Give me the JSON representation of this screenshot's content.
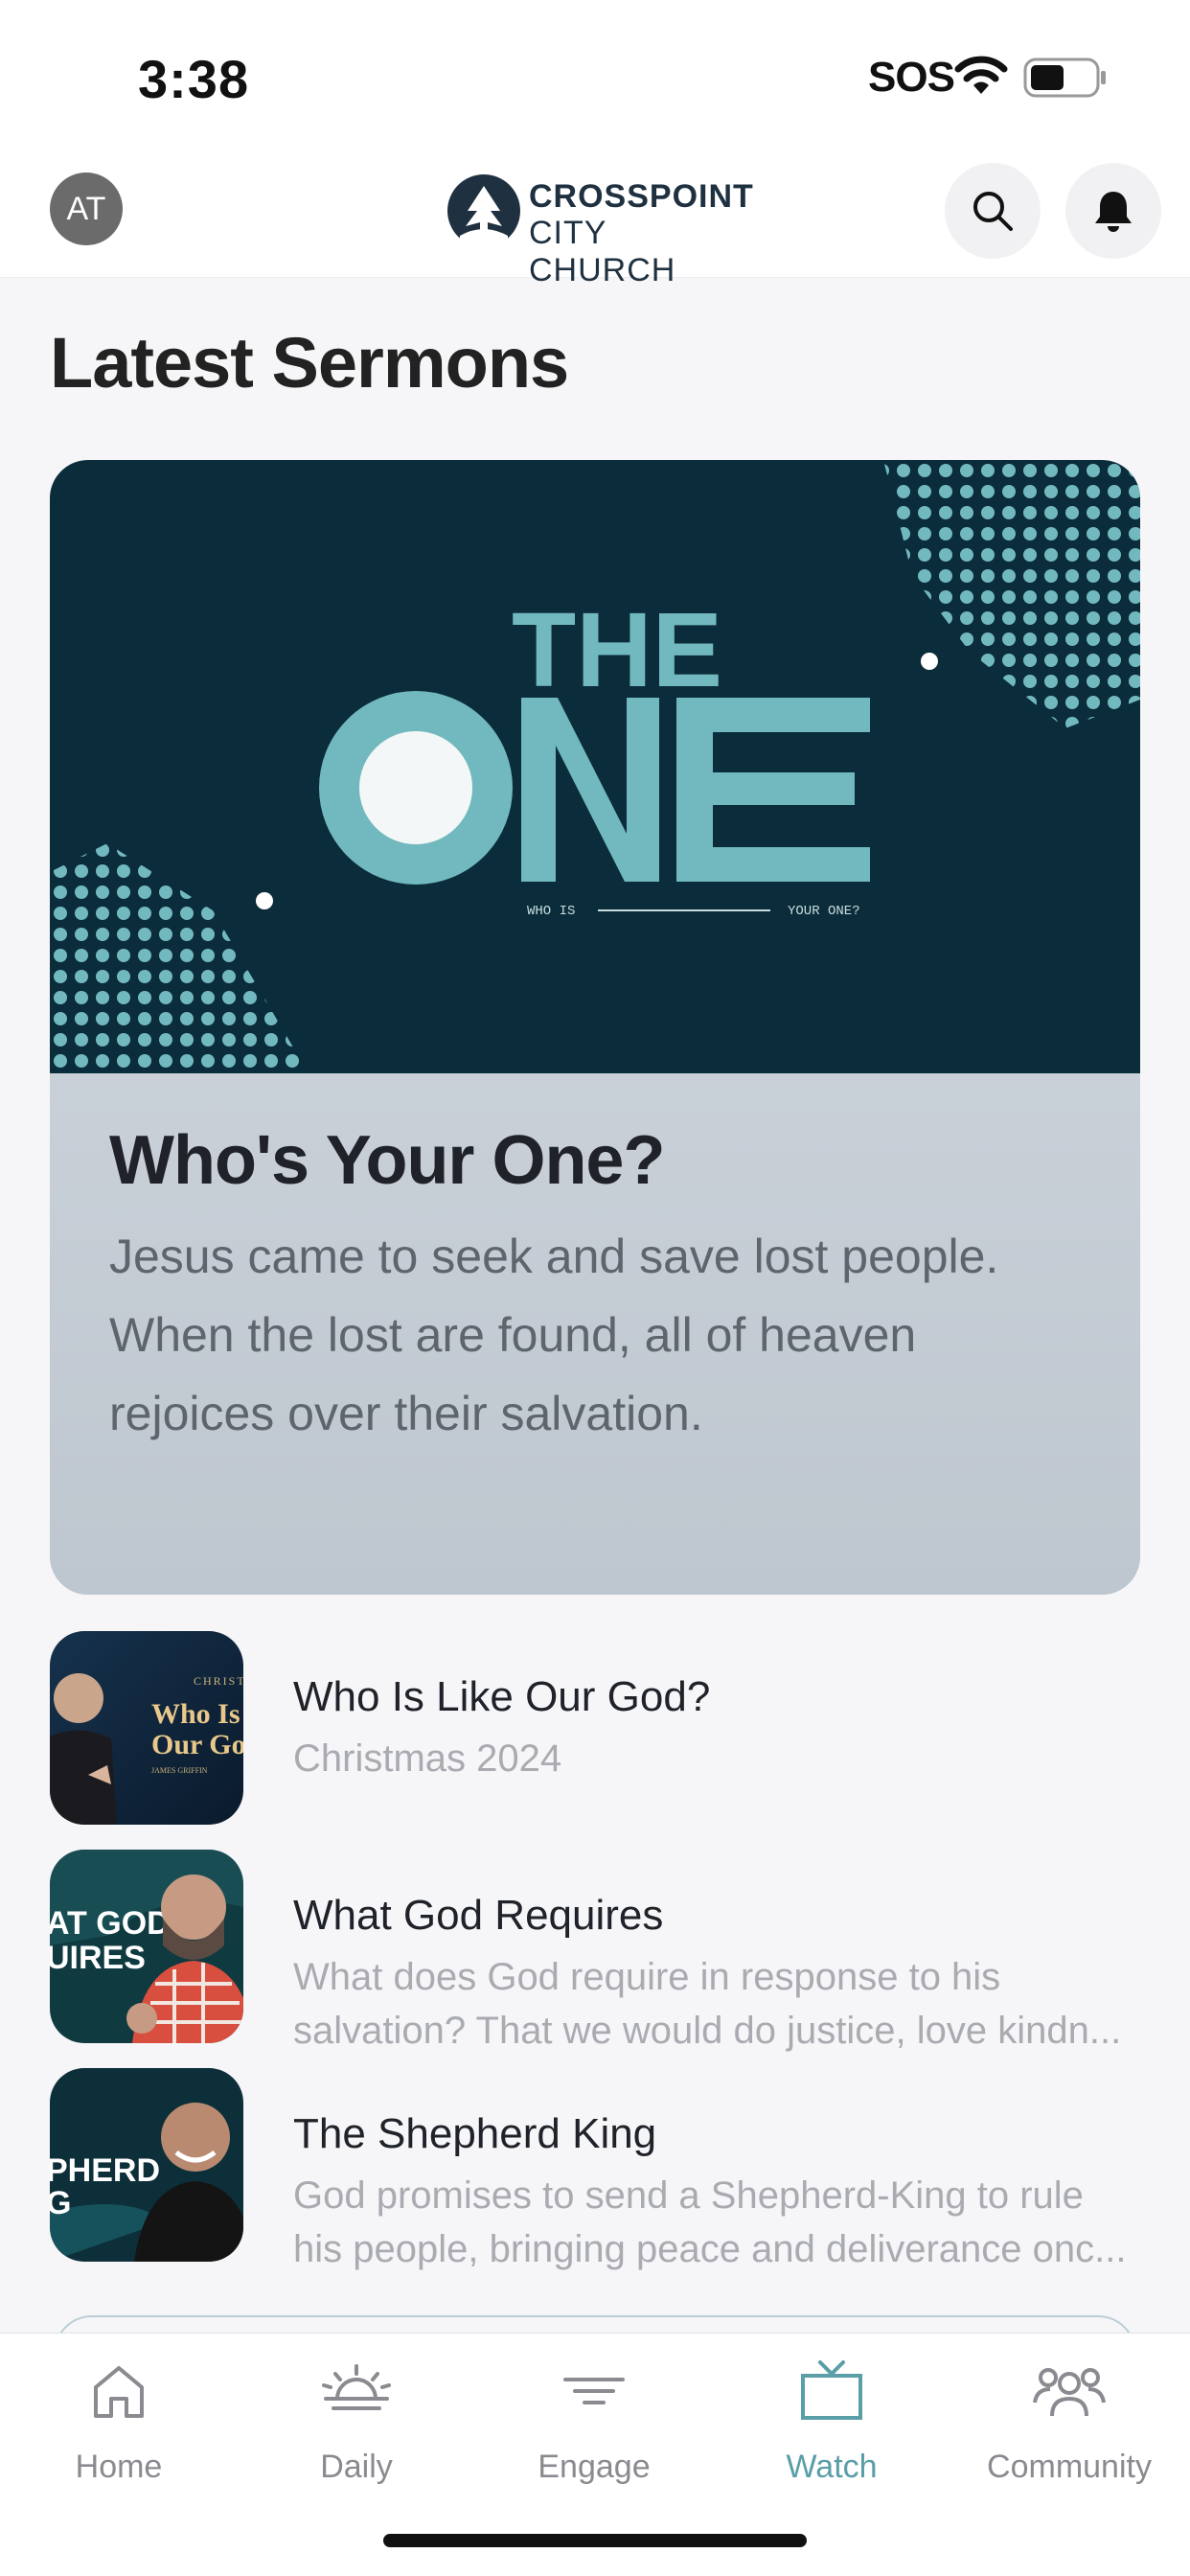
{
  "status_bar": {
    "time": "3:38",
    "carrier": "SOS"
  },
  "header": {
    "avatar_initials": "AT",
    "logo_line1": "CROSSPOINT",
    "logo_line2": "CITY CHURCH"
  },
  "section_title": "Latest Sermons",
  "featured": {
    "art_the": "THE",
    "art_one": "ONE",
    "art_left_caption": "WHO IS",
    "art_right_caption": "YOUR ONE?",
    "title": "Who's Your One?",
    "description": "Jesus came to seek and save lost people. When the lost are found, all of heaven rejoices over their salvation."
  },
  "sermons": [
    {
      "title": "Who Is Like Our God?",
      "subtitle_line1": "Christmas 2024",
      "subtitle_line2": "",
      "thumb_text": "Who Is Our God"
    },
    {
      "title": "What God Requires",
      "subtitle_line1": "What does God require in response to his",
      "subtitle_line2": "salvation? That we would do justice, love kindn...",
      "thumb_text": "AT GOD UIRES"
    },
    {
      "title": "The Shepherd King",
      "subtitle_line1": "God promises to send a Shepherd-King to rule",
      "subtitle_line2": "his people, bringing peace and deliverance onc...",
      "thumb_text": "PHERD G"
    }
  ],
  "tabs": [
    {
      "label": "Home",
      "icon": "home-icon",
      "active": false
    },
    {
      "label": "Daily",
      "icon": "sunrise-icon",
      "active": false
    },
    {
      "label": "Engage",
      "icon": "filter-icon",
      "active": false
    },
    {
      "label": "Watch",
      "icon": "tv-icon",
      "active": true
    },
    {
      "label": "Community",
      "icon": "people-icon",
      "active": false
    }
  ],
  "colors": {
    "accent": "#5a9ea7",
    "art_bg": "#0b2c3a",
    "art_teal": "#72b9bf"
  }
}
